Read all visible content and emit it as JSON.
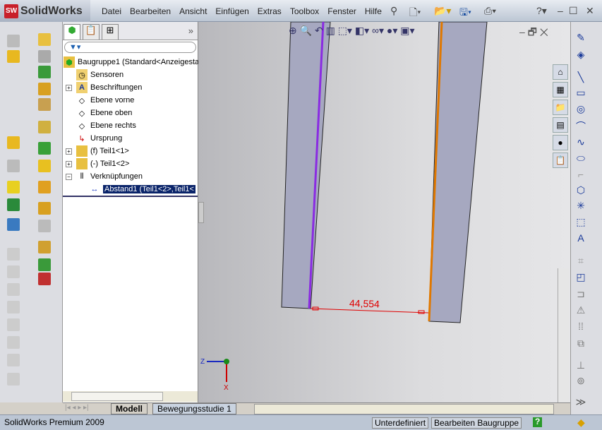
{
  "app": {
    "name": "SolidWorks",
    "version_label": "SolidWorks Premium 2009"
  },
  "menu": [
    "Datei",
    "Bearbeiten",
    "Ansicht",
    "Einfügen",
    "Extras",
    "Toolbox",
    "Fenster",
    "Hilfe"
  ],
  "tree": {
    "root": "Baugruppe1  (Standard<Anzeigesta",
    "items": [
      "Sensoren",
      "Beschriftungen",
      "Ebene vorne",
      "Ebene oben",
      "Ebene rechts",
      "Ursprung",
      "(f) Teil1<1>",
      "(-) Teil1<2>",
      "Verknüpfungen"
    ],
    "selected": "Abstand1 (Teil1<2>,Teil1<"
  },
  "viewport": {
    "dimension": "44,554",
    "axis_z": "Z",
    "axis_x": "X"
  },
  "bottom_tabs": [
    "Modell",
    "Bewegungsstudie 1"
  ],
  "status": {
    "state": "Unterdefiniert",
    "mode": "Bearbeiten Baugruppe"
  },
  "colors": {
    "selected_edge_1": "#8a2be2",
    "selected_edge_2": "#e07800",
    "dimension": "#e00000"
  }
}
